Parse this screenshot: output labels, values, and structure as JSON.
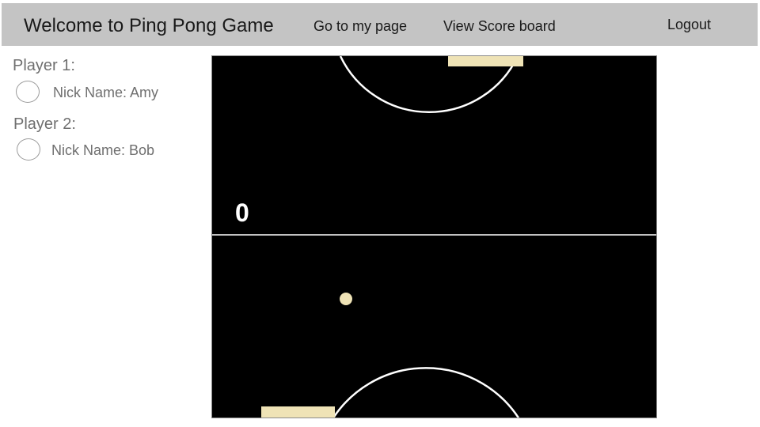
{
  "header": {
    "title": "Welcome to Ping Pong Game",
    "links": {
      "my_page": "Go to my page",
      "score_board": "View Score board",
      "logout": "Logout"
    }
  },
  "players": [
    {
      "heading": "Player 1:",
      "nickname": "Nick Name: Amy"
    },
    {
      "heading": "Player 2:",
      "nickname": "Nick Name: Bob"
    }
  ],
  "game": {
    "score": "0",
    "colors": {
      "board": "#000000",
      "lines": "#ffffff",
      "paddle": "#efe3b6",
      "ball": "#efe3b6"
    }
  }
}
